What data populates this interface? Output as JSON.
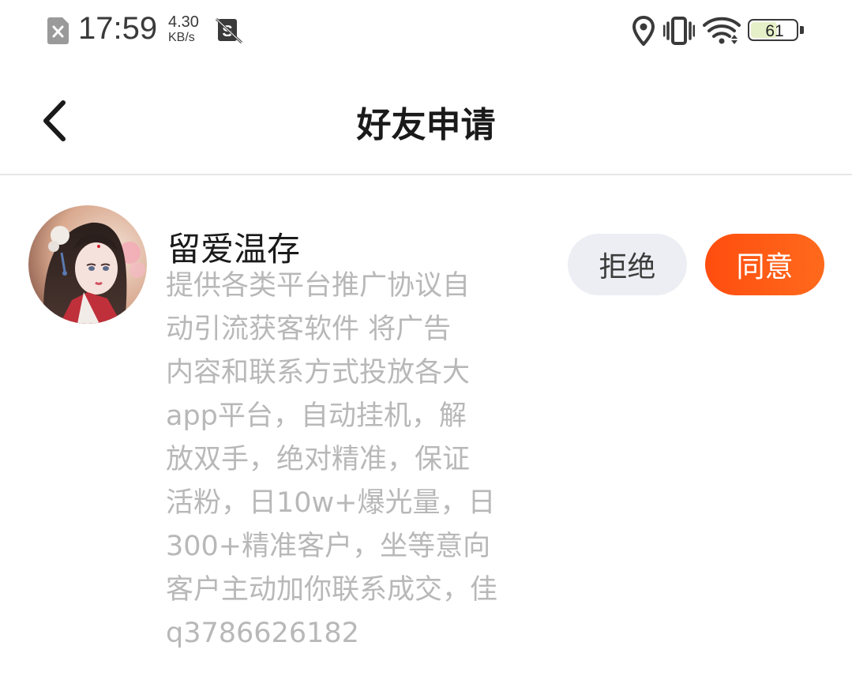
{
  "status_bar": {
    "time": "17:59",
    "net_speed_value": "4.30",
    "net_speed_unit": "KB/s",
    "battery_level": 61,
    "battery_label": "61",
    "icons": [
      "no-sim-icon",
      "no-sim-card-2-icon",
      "location-icon",
      "vibrate-icon",
      "wifi-icon",
      "battery-icon"
    ]
  },
  "nav": {
    "title": "好友申请",
    "back_icon": "chevron-left-icon"
  },
  "friend_request": {
    "name": "留爱温存",
    "message": "提供各类平台推广协议自\n动引流获客软件 将广告\n内容和联系方式投放各大\napp平台，自动挂机，解\n放双手，绝对精准，保证\n活粉，日10w+爆光量，日\n300+精准客户，坐等意向\n客户主动加你联系成交，佳\nq3786626182",
    "reject_label": "拒绝",
    "accept_label": "同意"
  },
  "colors": {
    "accent": "#ff5a14",
    "reject_bg": "#eceef3",
    "message_text": "#b8b8b8",
    "divider": "#e6e6e6"
  }
}
